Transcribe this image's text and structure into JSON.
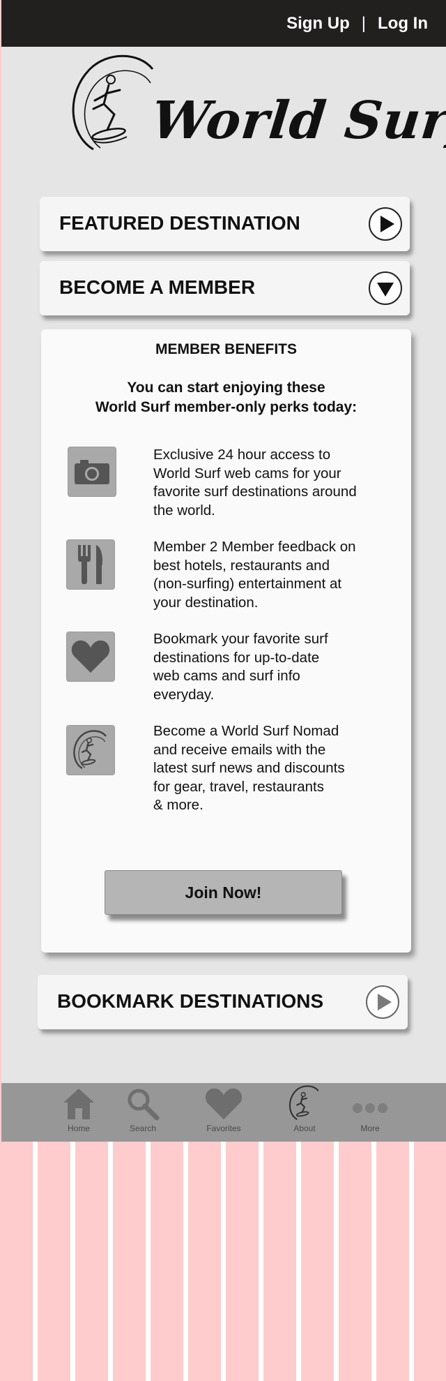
{
  "header": {
    "signup_label": "Sign Up",
    "separator": "|",
    "login_label": "Log In"
  },
  "brand": {
    "name": "World Surf"
  },
  "sections": {
    "featured": "FEATURED DESTINATION",
    "member": "BECOME A MEMBER",
    "bookmark": "BOOKMARK DESTINATIONS"
  },
  "benefits": {
    "title": "MEMBER BENEFITS",
    "intro_line1": "You can start enjoying these",
    "intro_line2": "World Surf member-only perks today:",
    "items": [
      {
        "icon": "camera-icon",
        "lines": [
          "Exclusive 24 hour access to",
          "World Surf web cams for your",
          "favorite surf destinations around",
          "the world."
        ]
      },
      {
        "icon": "fork-knife-icon",
        "lines": [
          "Member 2 Member feedback on",
          "best hotels, restaurants and",
          "(non-surfing) entertainment at",
          "your destination."
        ]
      },
      {
        "icon": "heart-icon",
        "lines": [
          "Bookmark your favorite surf",
          "destinations for up-to-date",
          "web cams and surf info",
          "everyday."
        ]
      },
      {
        "icon": "surfer-logo-icon",
        "lines": [
          "Become a World Surf Nomad",
          "and receive emails with the",
          "latest surf news and discounts",
          "for gear, travel, restaurants",
          "& more."
        ]
      }
    ],
    "join_label": "Join Now!"
  },
  "tabbar": {
    "items": [
      {
        "label": "Home",
        "icon": "home-icon"
      },
      {
        "label": "Search",
        "icon": "search-icon"
      },
      {
        "label": "Favorites",
        "icon": "heart-icon"
      },
      {
        "label": "About",
        "icon": "surfer-logo-icon"
      },
      {
        "label": "More",
        "icon": "more-dots-icon"
      }
    ]
  },
  "colors": {
    "topbar": "#221f1f",
    "background": "#e5e5e5",
    "card": "#f5f5f5",
    "tabbar": "#979797",
    "stripes": "#fecccc"
  }
}
